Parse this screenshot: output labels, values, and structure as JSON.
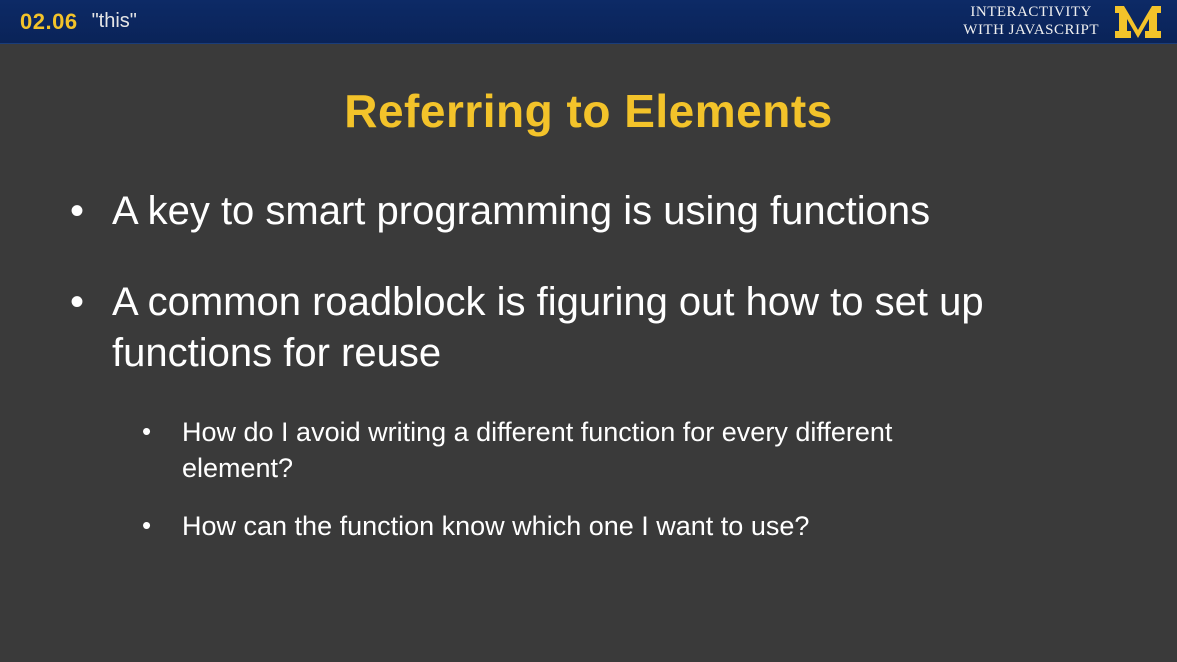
{
  "topbar": {
    "lesson_number": "02.06",
    "lesson_title": "\"this\"",
    "course_line1": "INTERACTIVITY",
    "course_line2": "WITH JAVASCRIPT"
  },
  "slide": {
    "title": "Referring to Elements",
    "bullets": [
      {
        "text": "A key to smart programming is using functions"
      },
      {
        "text": "A common roadblock is figuring out how to set up functions for reuse",
        "sub": [
          "How do I avoid writing a different function for every different element?",
          "How can the function know which one I want to use?"
        ]
      }
    ]
  },
  "colors": {
    "accent": "#f3c32a",
    "background": "#3a3a3a",
    "topbar": "#0a2358",
    "text": "#ffffff"
  }
}
